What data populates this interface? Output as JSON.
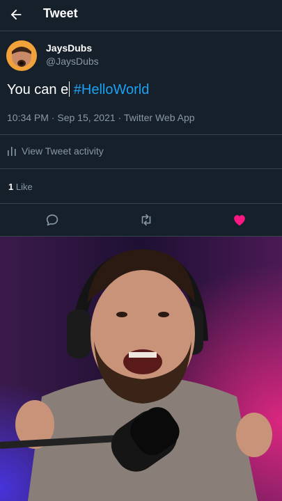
{
  "header": {
    "title": "Tweet",
    "back_icon": "arrow-left-icon"
  },
  "tweet": {
    "author_name": "JaysDubs",
    "author_handle": "@JaysDubs",
    "text_plain": "You can e",
    "hashtag": "#HelloWorld",
    "meta": "10:34 PM · Sep 15, 2021 · Twitter Web App",
    "activity_label": "View Tweet activity",
    "like_count": "1",
    "like_label": "Like"
  },
  "actions": [
    {
      "icon": "reply-icon"
    },
    {
      "icon": "retweet-icon"
    },
    {
      "icon": "heart-icon-liked"
    }
  ],
  "colors": {
    "background": "#15202b",
    "divider": "#38444d",
    "secondary_text": "#8899a6",
    "link": "#1da1f2",
    "liked": "#f91880"
  }
}
